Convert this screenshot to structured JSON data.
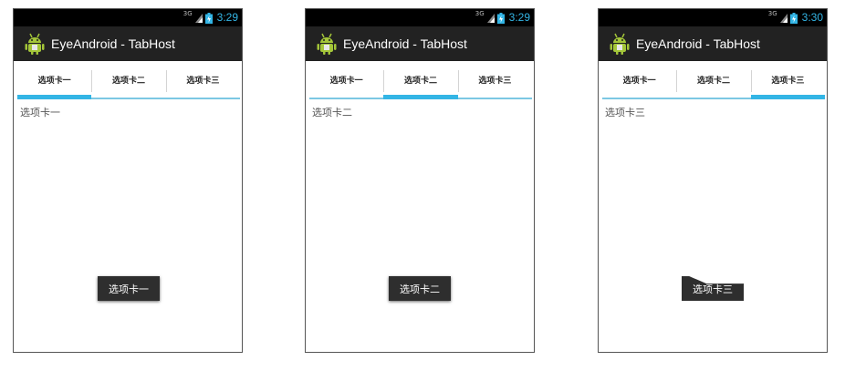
{
  "screens": [
    {
      "status": {
        "network": "3G",
        "time": "3:29"
      },
      "app_title": "EyeAndroid - TabHost",
      "tabs": [
        {
          "label": "选项卡一",
          "active": true
        },
        {
          "label": "选项卡二",
          "active": false
        },
        {
          "label": "选项卡三",
          "active": false
        }
      ],
      "content": "选项卡一",
      "toast": "选项卡一"
    },
    {
      "status": {
        "network": "3G",
        "time": "3:29"
      },
      "app_title": "EyeAndroid - TabHost",
      "tabs": [
        {
          "label": "选项卡一",
          "active": false
        },
        {
          "label": "选项卡二",
          "active": true
        },
        {
          "label": "选项卡三",
          "active": false
        }
      ],
      "content": "选项卡二",
      "toast": "选项卡二"
    },
    {
      "status": {
        "network": "3G",
        "time": "3:30"
      },
      "app_title": "EyeAndroid - TabHost",
      "tabs": [
        {
          "label": "选项卡一",
          "active": false
        },
        {
          "label": "选项卡二",
          "active": false
        },
        {
          "label": "选项卡三",
          "active": true
        }
      ],
      "content": "选项卡三",
      "toast": "选项卡三"
    }
  ],
  "colors": {
    "accent": "#33b5e5",
    "action_bar": "#222222",
    "status_bar": "#000000"
  },
  "icons": {
    "app": "android-robot-icon",
    "signal": "signal-icon",
    "battery": "battery-charging-icon"
  }
}
